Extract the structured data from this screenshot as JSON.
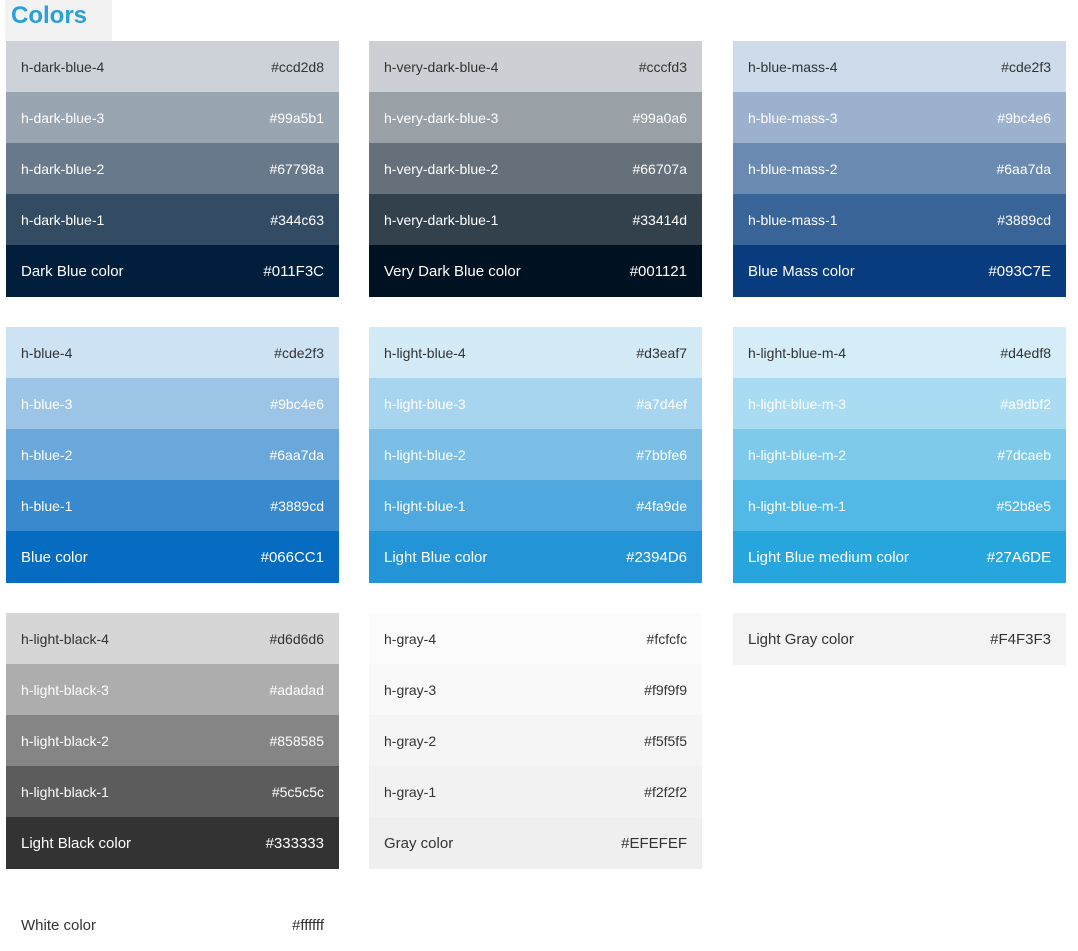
{
  "page": {
    "title": "Colors"
  },
  "palettes": [
    {
      "id": "dark-blue",
      "rows": [
        {
          "label": "h-dark-blue-4",
          "hex": "#ccd2d8",
          "bg": "#ccd2d8",
          "fg": "#333333"
        },
        {
          "label": "h-dark-blue-3",
          "hex": "#99a5b1",
          "bg": "#99a5b1",
          "fg": "#ffffff"
        },
        {
          "label": "h-dark-blue-2",
          "hex": "#67798a",
          "bg": "#67798a",
          "fg": "#ffffff"
        },
        {
          "label": "h-dark-blue-1",
          "hex": "#344c63",
          "bg": "#344c63",
          "fg": "#ffffff"
        },
        {
          "label": "Dark Blue color",
          "hex": "#011F3C",
          "bg": "#011f3c",
          "fg": "#ffffff",
          "base": true
        }
      ]
    },
    {
      "id": "very-dark-blue",
      "rows": [
        {
          "label": "h-very-dark-blue-4",
          "hex": "#cccfd3",
          "bg": "#cccfd3",
          "fg": "#333333"
        },
        {
          "label": "h-very-dark-blue-3",
          "hex": "#99a0a6",
          "bg": "#99a0a6",
          "fg": "#ffffff"
        },
        {
          "label": "h-very-dark-blue-2",
          "hex": "#66707a",
          "bg": "#66707a",
          "fg": "#ffffff"
        },
        {
          "label": "h-very-dark-blue-1",
          "hex": "#33414d",
          "bg": "#33414d",
          "fg": "#ffffff"
        },
        {
          "label": "Very Dark Blue color",
          "hex": "#001121",
          "bg": "#001121",
          "fg": "#ffffff",
          "base": true
        }
      ]
    },
    {
      "id": "blue-mass",
      "rows": [
        {
          "label": "h-blue-mass-4",
          "hex": "#cde2f3",
          "bg": "#cddbea",
          "fg": "#333333"
        },
        {
          "label": "h-blue-mass-3",
          "hex": "#9bc4e6",
          "bg": "#9bb1cd",
          "fg": "#ffffff"
        },
        {
          "label": "h-blue-mass-2",
          "hex": "#6aa7da",
          "bg": "#6a8ab1",
          "fg": "#ffffff"
        },
        {
          "label": "h-blue-mass-1",
          "hex": "#3889cd",
          "bg": "#386497",
          "fg": "#ffffff"
        },
        {
          "label": "Blue Mass color",
          "hex": "#093C7E",
          "bg": "#093c7e",
          "fg": "#ffffff",
          "base": true
        }
      ]
    },
    {
      "id": "blue",
      "rows": [
        {
          "label": "h-blue-4",
          "hex": "#cde2f3",
          "bg": "#cde2f3",
          "fg": "#333333"
        },
        {
          "label": "h-blue-3",
          "hex": "#9bc4e6",
          "bg": "#9bc4e6",
          "fg": "#ffffff"
        },
        {
          "label": "h-blue-2",
          "hex": "#6aa7da",
          "bg": "#6aa7da",
          "fg": "#ffffff"
        },
        {
          "label": "h-blue-1",
          "hex": "#3889cd",
          "bg": "#3889cd",
          "fg": "#ffffff"
        },
        {
          "label": "Blue color",
          "hex": "#066CC1",
          "bg": "#066cc1",
          "fg": "#ffffff",
          "base": true
        }
      ]
    },
    {
      "id": "light-blue",
      "rows": [
        {
          "label": "h-light-blue-4",
          "hex": "#d3eaf7",
          "bg": "#d3eaf7",
          "fg": "#333333"
        },
        {
          "label": "h-light-blue-3",
          "hex": "#a7d4ef",
          "bg": "#a7d4ef",
          "fg": "#ffffff"
        },
        {
          "label": "h-light-blue-2",
          "hex": "#7bbfe6",
          "bg": "#7bbfe6",
          "fg": "#ffffff"
        },
        {
          "label": "h-light-blue-1",
          "hex": "#4fa9de",
          "bg": "#4fa9de",
          "fg": "#ffffff"
        },
        {
          "label": "Light Blue color",
          "hex": "#2394D6",
          "bg": "#2394d6",
          "fg": "#ffffff",
          "base": true
        }
      ]
    },
    {
      "id": "light-blue-medium",
      "rows": [
        {
          "label": "h-light-blue-m-4",
          "hex": "#d4edf8",
          "bg": "#d4edf8",
          "fg": "#333333"
        },
        {
          "label": "h-light-blue-m-3",
          "hex": "#a9dbf2",
          "bg": "#a9dbf2",
          "fg": "#ffffff"
        },
        {
          "label": "h-light-blue-m-2",
          "hex": "#7dcaeb",
          "bg": "#7dcaeb",
          "fg": "#ffffff"
        },
        {
          "label": "h-light-blue-m-1",
          "hex": "#52b8e5",
          "bg": "#52b8e5",
          "fg": "#ffffff"
        },
        {
          "label": "Light Blue medium color",
          "hex": "#27A6DE",
          "bg": "#27a6de",
          "fg": "#ffffff",
          "base": true
        }
      ]
    },
    {
      "id": "light-black",
      "rows": [
        {
          "label": "h-light-black-4",
          "hex": "#d6d6d6",
          "bg": "#d6d6d6",
          "fg": "#333333"
        },
        {
          "label": "h-light-black-3",
          "hex": "#adadad",
          "bg": "#adadad",
          "fg": "#ffffff"
        },
        {
          "label": "h-light-black-2",
          "hex": "#858585",
          "bg": "#858585",
          "fg": "#ffffff"
        },
        {
          "label": "h-light-black-1",
          "hex": "#5c5c5c",
          "bg": "#5c5c5c",
          "fg": "#ffffff"
        },
        {
          "label": "Light Black color",
          "hex": "#333333",
          "bg": "#333333",
          "fg": "#ffffff",
          "base": true
        }
      ]
    },
    {
      "id": "gray",
      "rows": [
        {
          "label": "h-gray-4",
          "hex": "#fcfcfc",
          "bg": "#fcfcfc",
          "fg": "#333333"
        },
        {
          "label": "h-gray-3",
          "hex": "#f9f9f9",
          "bg": "#f9f9f9",
          "fg": "#333333"
        },
        {
          "label": "h-gray-2",
          "hex": "#f5f5f5",
          "bg": "#f5f5f5",
          "fg": "#333333"
        },
        {
          "label": "h-gray-1",
          "hex": "#f2f2f2",
          "bg": "#f2f2f2",
          "fg": "#333333"
        },
        {
          "label": "Gray color",
          "hex": "#EFEFEF",
          "bg": "#efefef",
          "fg": "#333333",
          "base": true
        }
      ]
    },
    {
      "id": "light-gray",
      "rows": [
        {
          "label": "Light Gray color",
          "hex": "#F4F3F3",
          "bg": "#f4f3f3",
          "fg": "#333333",
          "base": true
        }
      ]
    },
    {
      "id": "white",
      "rows": [
        {
          "label": "White color",
          "hex": "#ffffff",
          "bg": "#ffffff",
          "fg": "#333333",
          "base": true
        }
      ]
    }
  ]
}
